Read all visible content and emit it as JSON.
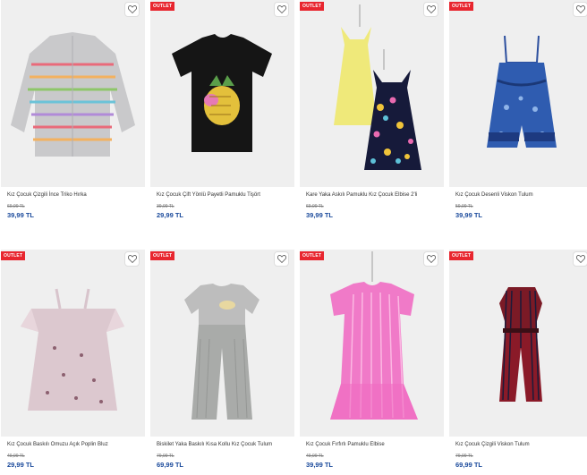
{
  "badge_label": "OUTLET",
  "icons": {
    "favorite": "heart-outline-icon"
  },
  "colors": {
    "badge": "#e8262f",
    "price": "#1c4b9c"
  },
  "products": [
    {
      "title": "Kız Çocuk Çizgili İnce Triko Hırka",
      "old_price": "69,99 TL",
      "price": "39,99 TL",
      "has_badge": false
    },
    {
      "title": "Kız Çocuk Çift Yönlü Payetli Pamuklu Tişört",
      "old_price": "39,99 TL",
      "price": "29,99 TL",
      "has_badge": true
    },
    {
      "title": "Kare Yaka Askılı Pamuklu Kız Çocuk Elbise 2'li",
      "old_price": "69,99 TL",
      "price": "39,99 TL",
      "has_badge": true
    },
    {
      "title": "Kız Çocuk Desenli Viskon Tulum",
      "old_price": "59,99 TL",
      "price": "39,99 TL",
      "has_badge": true
    },
    {
      "title": "Kız Çocuk Baskılı Omuzu Açık Poplin Bluz",
      "old_price": "49,99 TL",
      "price": "29,99 TL",
      "has_badge": true
    },
    {
      "title": "Biskilet Yaka Baskılı Kısa Kollu Kız Çocuk Tulum",
      "old_price": "79,99 TL",
      "price": "69,99 TL",
      "has_badge": true
    },
    {
      "title": "Kız Çocuk Fırfırlı Pamuklu Elbise",
      "old_price": "49,99 TL",
      "price": "39,99 TL",
      "has_badge": true
    },
    {
      "title": "Kız Çocuk Çizgili Viskon Tulum",
      "old_price": "79,99 TL",
      "price": "69,99 TL",
      "has_badge": true
    }
  ]
}
